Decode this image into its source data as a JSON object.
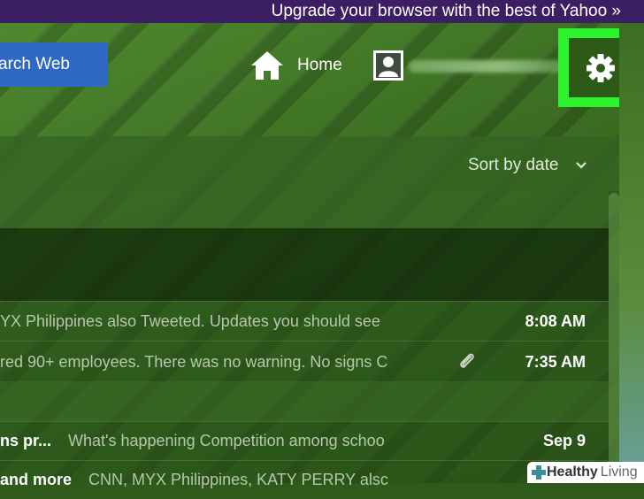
{
  "banner": {
    "text": "Upgrade your browser with the best of Yahoo »"
  },
  "header": {
    "search_button_label": "arch Web",
    "home_label": "Home",
    "icons": {
      "home": "home-icon",
      "profile": "profile-icon",
      "settings": "gear-icon"
    }
  },
  "toolbar": {
    "sort_label": "Sort by date"
  },
  "messages": [
    {
      "sender": "",
      "snippet": "YX Philippines also Tweeted. Updates you should see",
      "time": "8:08 AM",
      "attachment": false
    },
    {
      "sender": "",
      "snippet": "red 90+ employees. There was no warning. No signs C",
      "time": "7:35 AM",
      "attachment": true
    },
    {
      "sender": "ns pr...",
      "snippet": "What's happening Competition among schoo",
      "time": "Sep 9",
      "attachment": false
    },
    {
      "sender": "and more",
      "snippet": "CNN, MYX Philippines, KATY PERRY alsc",
      "time": "",
      "attachment": false
    }
  ],
  "watermark": {
    "bold": "Healthy",
    "light": "Living"
  },
  "colors": {
    "highlight": "#2cf32c",
    "banner": "#3c1f63",
    "search": "#3069c4"
  }
}
